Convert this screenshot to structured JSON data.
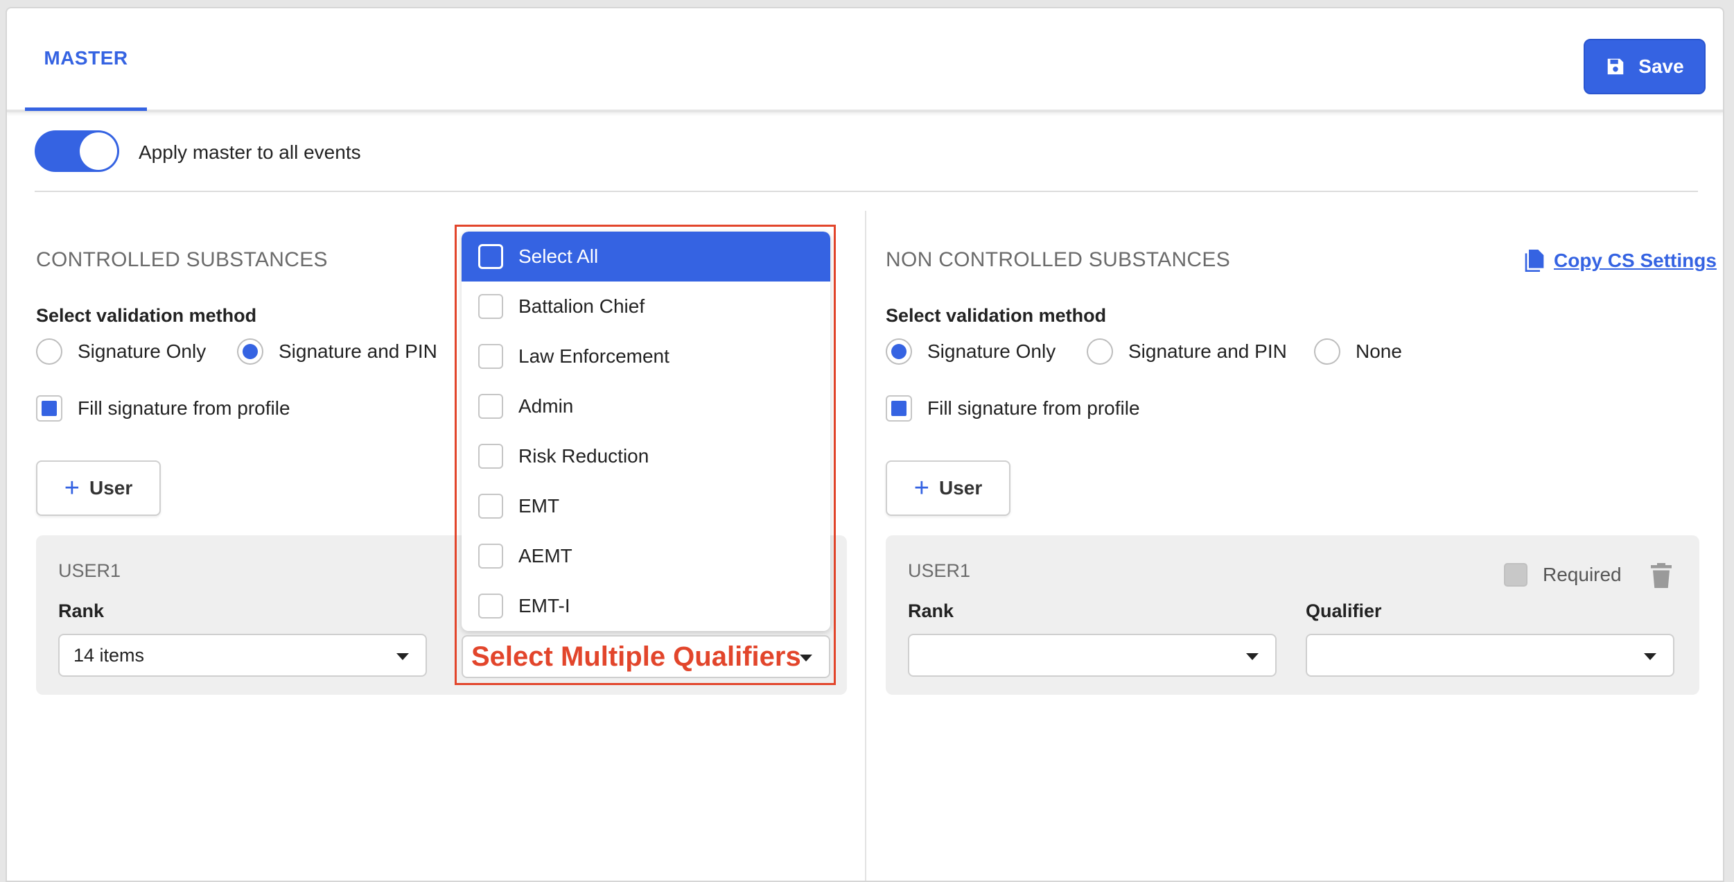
{
  "header": {
    "tab_label": "MASTER",
    "save_label": "Save"
  },
  "toggle": {
    "label": "Apply master to all events",
    "on": true
  },
  "controlled": {
    "title": "CONTROLLED SUBSTANCES",
    "validation_heading": "Select validation method",
    "options": [
      "Signature Only",
      "Signature and PIN"
    ],
    "selected": "Signature and PIN",
    "fill_signature_label": "Fill signature from profile",
    "fill_signature_checked": true,
    "add_user_label": "User",
    "card": {
      "user": "USER1",
      "rank_label": "Rank",
      "rank_value": "14 items"
    }
  },
  "non_controlled": {
    "title": "NON CONTROLLED SUBSTANCES",
    "copy_link": "Copy CS Settings",
    "validation_heading": "Select validation method",
    "options": [
      "Signature Only",
      "Signature and PIN",
      "None"
    ],
    "selected": "Signature Only",
    "fill_signature_label": "Fill signature from profile",
    "fill_signature_checked": true,
    "add_user_label": "User",
    "card": {
      "user": "USER1",
      "required_label": "Required",
      "rank_label": "Rank",
      "qualifier_label": "Qualifier",
      "rank_value": "",
      "qualifier_value": ""
    }
  },
  "qualifier_dropdown": {
    "options": [
      "Select All",
      "Battalion Chief",
      "Law Enforcement",
      "Admin",
      "Risk Reduction",
      "EMT",
      "AEMT",
      "EMT-I"
    ],
    "highlighted": "Select All",
    "annotation": "Select Multiple Qualifiers"
  },
  "colors": {
    "accent": "#3563e2",
    "annotation": "#e2452b"
  }
}
